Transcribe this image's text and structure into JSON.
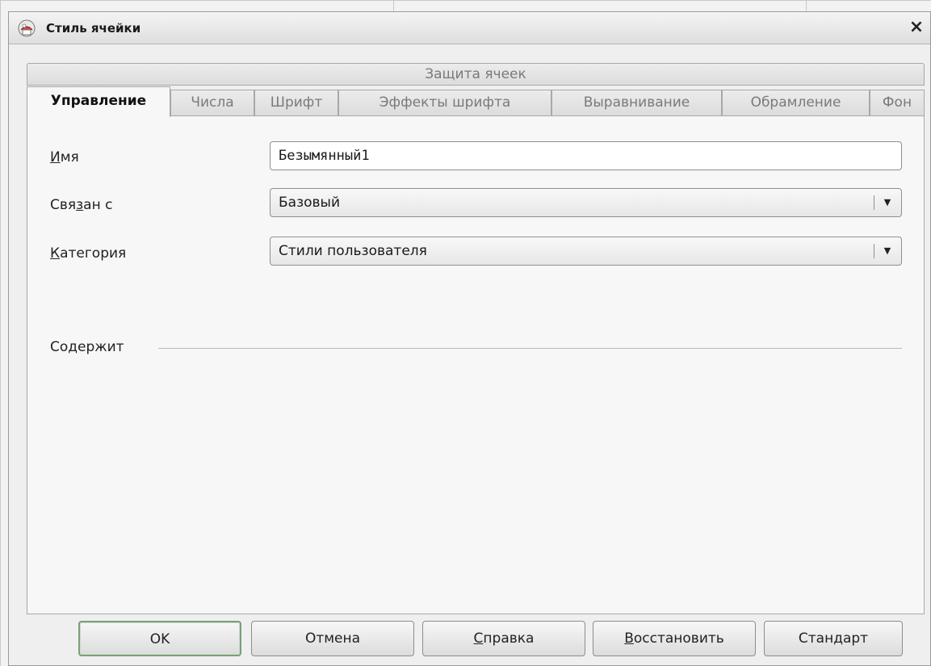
{
  "window": {
    "title": "Стиль ячейки",
    "close_label": "×"
  },
  "tabs_top": {
    "label": "Защита ячеек"
  },
  "tabs": [
    {
      "label": "Управление",
      "active": true
    },
    {
      "label": "Числа",
      "active": false
    },
    {
      "label": "Шрифт",
      "active": false
    },
    {
      "label": "Эффекты шрифта",
      "active": false
    },
    {
      "label": "Выравнивание",
      "active": false
    },
    {
      "label": "Обрамление",
      "active": false
    },
    {
      "label": "Фон",
      "active": false
    }
  ],
  "form": {
    "name": {
      "label_prefix": "",
      "label_underlined": "И",
      "label_rest": "мя",
      "value": "Безымянный1"
    },
    "linked": {
      "label_prefix": "Свя",
      "label_underlined": "з",
      "label_rest": "ан с",
      "value": "Базовый"
    },
    "category": {
      "label_prefix": "",
      "label_underlined": "К",
      "label_rest": "атегория",
      "value": "Стили пользователя"
    },
    "contains_label": "Содержит"
  },
  "buttons": {
    "ok": {
      "prefix": "OK",
      "underlined": "",
      "rest": ""
    },
    "cancel": {
      "prefix": "Отмена",
      "underlined": "",
      "rest": ""
    },
    "help": {
      "prefix": "",
      "underlined": "С",
      "rest": "правка"
    },
    "reset": {
      "prefix": "",
      "underlined": "В",
      "rest": "осстановить"
    },
    "standard": {
      "prefix": "Стан",
      "underlined": "д",
      "rest": "арт"
    }
  },
  "icons": {
    "app": "calc-style-icon",
    "close": "close-icon",
    "dropdown": "chevron-down-icon"
  },
  "colors": {
    "dialog_bg": "#efefef",
    "panel_bg": "#f7f7f7",
    "default_button_border": "#7aa07a"
  }
}
